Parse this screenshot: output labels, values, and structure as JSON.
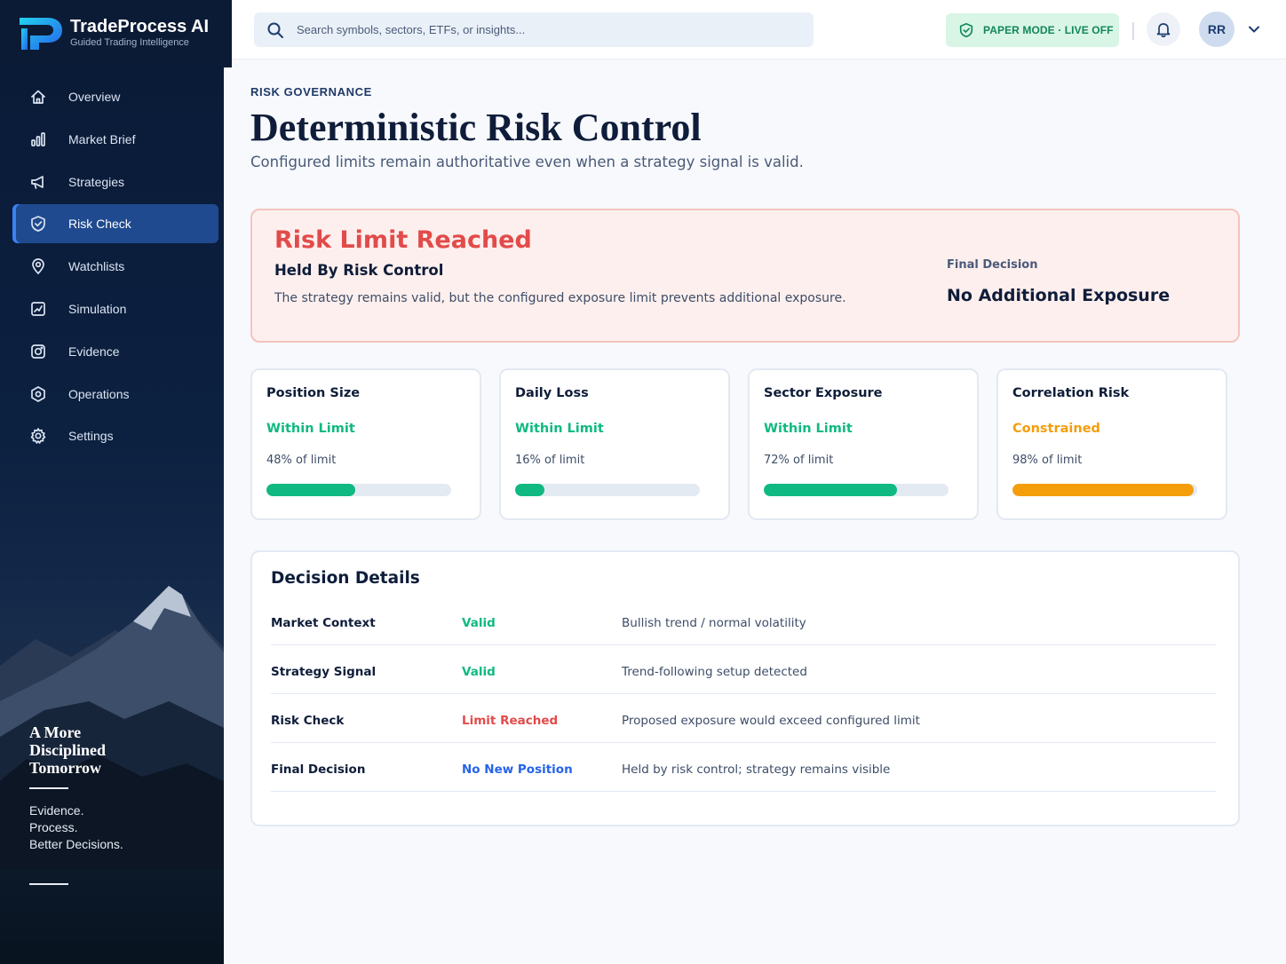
{
  "brand": {
    "name": "TradeProcess AI",
    "tagline": "Guided Trading Intelligence"
  },
  "search": {
    "placeholder": "Search symbols, sectors, ETFs, or insights..."
  },
  "mode_badge": "PAPER MODE · LIVE OFF",
  "user": {
    "initials": "RR"
  },
  "sidebar": {
    "items": [
      {
        "label": "Overview",
        "icon": "home-icon"
      },
      {
        "label": "Market Brief",
        "icon": "bar-chart-icon"
      },
      {
        "label": "Strategies",
        "icon": "megaphone-icon"
      },
      {
        "label": "Risk Check",
        "icon": "shield-icon",
        "active": true
      },
      {
        "label": "Watchlists",
        "icon": "location-pin-icon"
      },
      {
        "label": "Simulation",
        "icon": "chart-box-icon"
      },
      {
        "label": "Evidence",
        "icon": "camera-icon"
      },
      {
        "label": "Operations",
        "icon": "hexagon-icon"
      },
      {
        "label": "Settings",
        "icon": "gear-icon"
      }
    ],
    "promo_title": "A More\nDisciplined\nTomorrow",
    "promo_lines": "Evidence.\nProcess.\nBetter Decisions."
  },
  "page": {
    "eyebrow": "RISK GOVERNANCE",
    "title": "Deterministic Risk Control",
    "subtitle": "Configured limits remain authoritative even when a strategy signal is valid."
  },
  "alert": {
    "title": "Risk Limit Reached",
    "subtitle": "Held By Risk Control",
    "description": "The strategy remains valid, but the configured exposure limit prevents additional exposure.",
    "final_label": "Final Decision",
    "final_value": "No Additional Exposure"
  },
  "metrics": [
    {
      "title": "Position Size",
      "status": "Within Limit",
      "pct_text": "48% of limit",
      "value": 0.48,
      "color": "#10b981",
      "status_color": "#10b981"
    },
    {
      "title": "Daily Loss",
      "status": "Within Limit",
      "pct_text": "16% of limit",
      "value": 0.16,
      "color": "#10b981",
      "status_color": "#10b981"
    },
    {
      "title": "Sector Exposure",
      "status": "Within Limit",
      "pct_text": "72% of limit",
      "value": 0.72,
      "color": "#10b981",
      "status_color": "#10b981"
    },
    {
      "title": "Correlation Risk",
      "status": "Constrained",
      "pct_text": "98% of limit",
      "value": 0.98,
      "color": "#f59e0b",
      "status_color": "#f59e0b"
    }
  ],
  "details": {
    "title": "Decision Details",
    "rows": [
      {
        "label": "Market Context",
        "status": "Valid",
        "status_color": "#10b981",
        "note": "Bullish trend / normal volatility"
      },
      {
        "label": "Strategy Signal",
        "status": "Valid",
        "status_color": "#10b981",
        "note": "Trend-following setup detected"
      },
      {
        "label": "Risk Check",
        "status": "Limit Reached",
        "status_color": "#e24b4a",
        "note": "Proposed exposure would exceed configured limit"
      },
      {
        "label": "Final Decision",
        "status": "No New Position",
        "status_color": "#2563eb",
        "note": "Held by risk control; strategy remains visible"
      }
    ]
  }
}
